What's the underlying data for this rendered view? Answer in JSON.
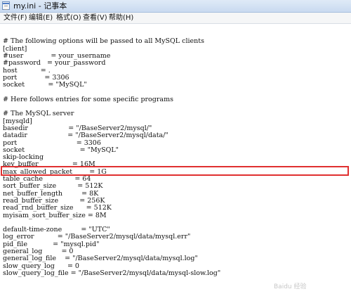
{
  "window": {
    "title": "my.ini - 记事本"
  },
  "menu": [
    "文件(F)",
    "编辑(E)",
    "格式(O)",
    "查看(V)",
    "帮助(H)"
  ],
  "editor": {
    "lines": [
      "",
      "# The following options will be passed to all MySQL clients",
      "[client]",
      "#user             = your_username",
      "#password   = your_password",
      "host           = .",
      "port             = 3306",
      "socket           = \"MySQL\"",
      "",
      "# Here follows entries for some specific programs",
      "",
      "# The MySQL server",
      "[mysqld]",
      "basedir                   = \"/BaseServer2/mysql/\"",
      "datadir                   = \"/BaseServer2/mysql/data/\"",
      "port                            = 3306",
      "socket                          = \"MySQL\"",
      "skip-locking",
      "key_buffer                = 16M",
      "max_allowed_packet        = 1G",
      "table_cache               = 64",
      "sort_buffer_size          = 512K",
      "net_buffer_length         = 8K",
      "read_buffer_size          = 256K",
      "read_rnd_buffer_size      = 512K",
      "myisam_sort_buffer_size = 8M",
      "",
      "default-time-zone         = \"UTC\"",
      "log_error           = \"/BaseServer2/mysql/data/mysql.err\"",
      "pid_file            = \"mysql.pid\"",
      "general_log         = 0",
      "general_log_file    = \"/BaseServer2/mysql/data/mysql.log\"",
      "slow_query_log      = 0",
      "slow_query_log_file = \"/BaseServer2/mysql/data/mysql-slow.log\""
    ]
  },
  "watermark": "Baidu 经验"
}
